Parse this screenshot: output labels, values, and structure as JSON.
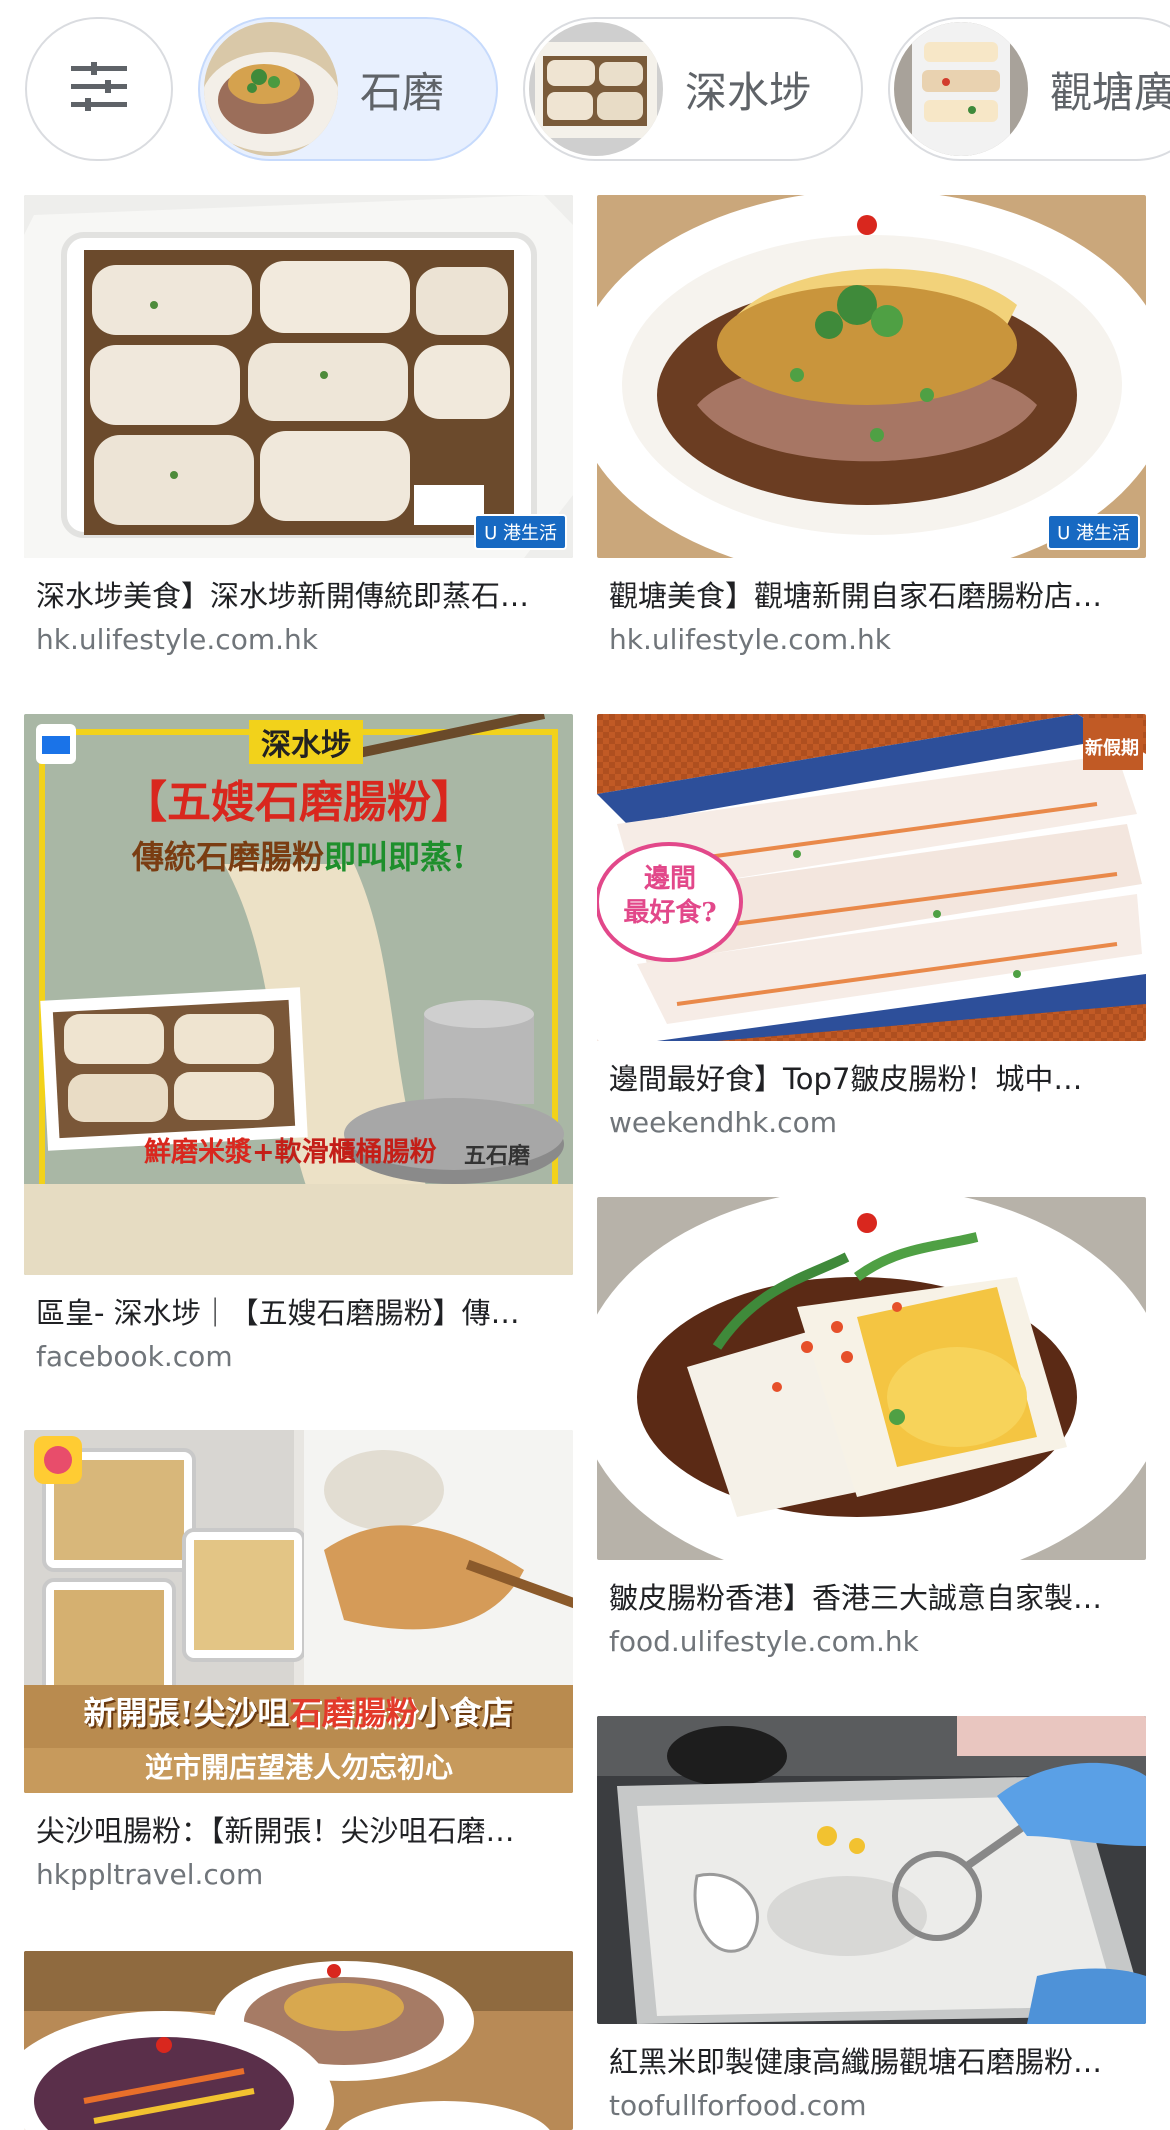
{
  "chips": {
    "filter_icon": "tune-icon",
    "items": [
      {
        "label": "石磨",
        "selected": true
      },
      {
        "label": "深水埗",
        "selected": false
      },
      {
        "label": "觀塘廣",
        "selected": false
      }
    ]
  },
  "results": [
    {
      "title": "深水埗美食】深水埗新開傳統即蒸石…",
      "source": "hk.ulifestyle.com.hk",
      "image_badge": "U 港生活"
    },
    {
      "title": "觀塘美食】觀塘新開自家石磨腸粉店…",
      "source": "hk.ulifestyle.com.hk",
      "image_badge": "U 港生活"
    },
    {
      "title": "區皇- 深水埗｜【五嫂石磨腸粉】傳…",
      "source": "facebook.com",
      "image_text": {
        "district": "深水埗",
        "shop": "【五嫂石磨腸粉】",
        "slogan_a": "傳統石磨腸粉",
        "slogan_b": "即叫即蒸!",
        "bottom_a": "鮮磨米漿",
        "bottom_b": "+軟滑櫃桶腸粉",
        "stone": "五石磨"
      }
    },
    {
      "title": "邊間最好食】Top7皺皮腸粉！城中…",
      "source": "weekendhk.com",
      "image_text": {
        "bubble_a": "邊間",
        "bubble_b": "最好食?",
        "logo": "新假期"
      }
    },
    {
      "title": "皺皮腸粉香港】香港三大誠意自家製…",
      "source": "food.ulifestyle.com.hk"
    },
    {
      "title": "尖沙咀腸粉：【新開張！尖沙咀石磨…",
      "source": "hkppltravel.com",
      "image_text": {
        "headline_a": "新開張!尖沙咀",
        "headline_b": "石磨腸粉",
        "headline_c": "小食店",
        "sub": "逆市開店望港人勿忘初心"
      }
    },
    {
      "title": "紅黑米即製健康高纖腸觀塘石磨腸粉…",
      "source": "toofullforfood.com"
    },
    {
      "title": "",
      "source": ""
    }
  ]
}
